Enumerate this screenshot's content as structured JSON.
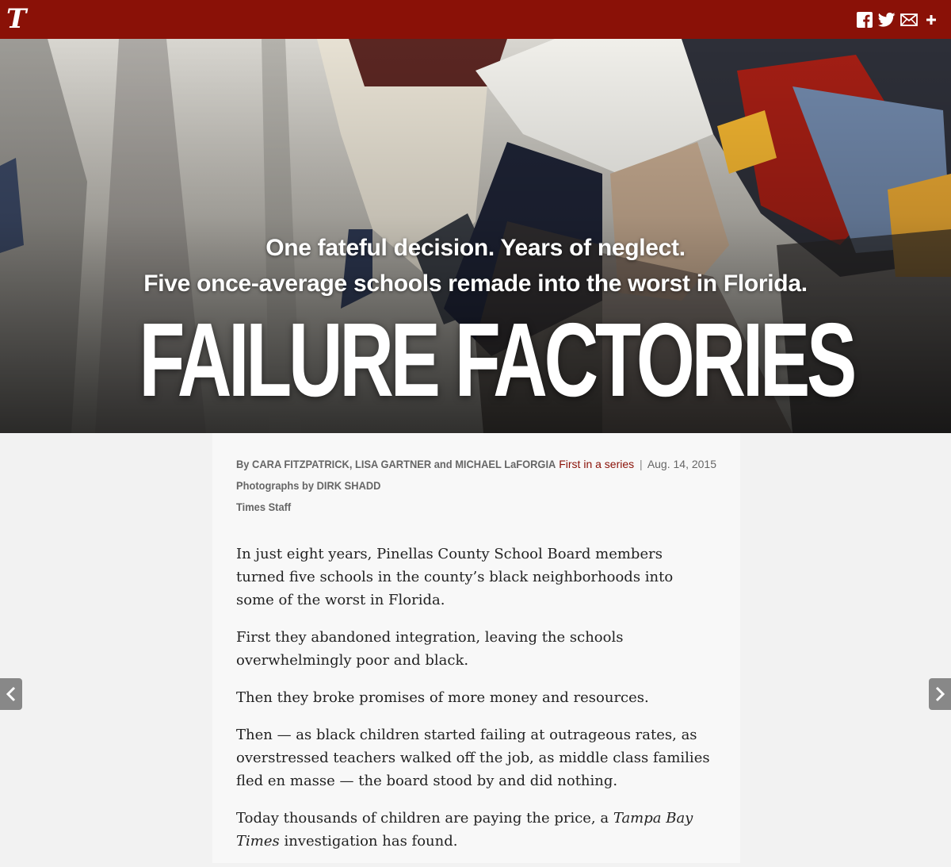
{
  "topbar": {
    "logo": "T",
    "colors": {
      "bar": "#8a1107"
    },
    "social": [
      {
        "name": "facebook-icon",
        "glyph": "f"
      },
      {
        "name": "twitter-icon",
        "glyph": "bird"
      },
      {
        "name": "email-icon",
        "glyph": "envelope"
      },
      {
        "name": "more-icon",
        "glyph": "+"
      }
    ]
  },
  "hero": {
    "dek_line1": "One fateful decision. Years of neglect.",
    "dek_line2": "Five once-average schools remade into the worst in Florida.",
    "headline": "FAILURE FACTORIES"
  },
  "article": {
    "byline": {
      "authors": "By CARA FITZPATRICK, LISA GARTNER and MICHAEL LaFORGIA",
      "photos": "Photographs by DIRK SHADD",
      "staff": "Times Staff"
    },
    "series": {
      "label": "First in a series",
      "separator": "|",
      "date": "Aug. 14, 2015"
    },
    "paragraphs": [
      "In just eight years, Pinellas County School Board members turned five schools in the county’s black neighborhoods into some of the worst in Florida.",
      "First they abandoned integration, leaving the schools overwhelmingly poor and black.",
      "Then they broke promises of more money and resources.",
      "Then — as black children started failing at outrageous rates, as overstressed teachers walked off the job, as middle class families fled en masse — the board stood by and did nothing."
    ],
    "last_paragraph": {
      "before": "Today thousands of children are paying the price, a ",
      "italic": "Tampa Bay Times",
      "after": " investigation has found."
    }
  },
  "nav": {
    "prev_icon": "chevron-left-icon",
    "next_icon": "chevron-right-icon"
  }
}
